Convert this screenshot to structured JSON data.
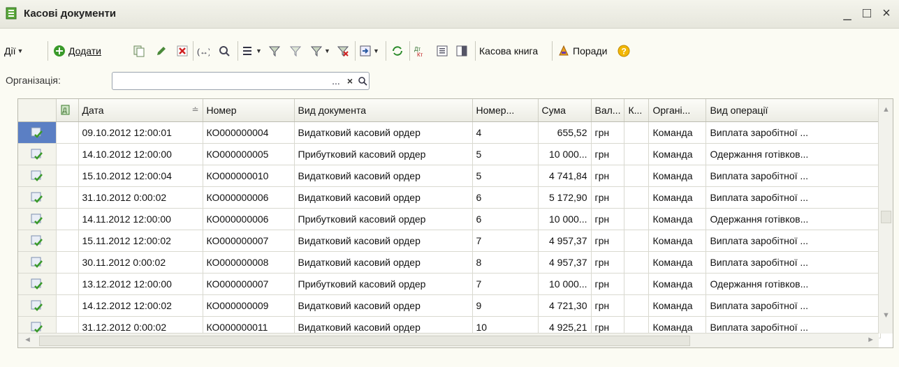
{
  "window": {
    "title": "Касові документи",
    "controls": {
      "minimize": "_",
      "maximize": "□",
      "close": "×"
    }
  },
  "toolbar": {
    "actions_label": "Дії",
    "add_label": "Додати",
    "cash_book_label": "Касова книга",
    "tips_label": "Поради"
  },
  "filter": {
    "organization_label": "Організація:",
    "organization_value": "",
    "select_button": "...",
    "clear_button": "×"
  },
  "table": {
    "columns": [
      "Дата",
      "Номер",
      "Вид документа",
      "Номер...",
      "Сума",
      "Вал...",
      "К...",
      "Органі...",
      "Вид операції"
    ],
    "rows": [
      [
        "09.10.2012 12:00:01",
        "КО000000004",
        "Видатковий касовий ордер",
        "4",
        "655,52",
        "грн",
        "",
        "Команда",
        "Виплата заробітної ..."
      ],
      [
        "14.10.2012 12:00:00",
        "КО000000005",
        "Прибутковий касовий ордер",
        "5",
        "10 000...",
        "грн",
        "",
        "Команда",
        "Одержання готівков..."
      ],
      [
        "15.10.2012 12:00:04",
        "КО000000010",
        "Видатковий касовий ордер",
        "5",
        "4 741,84",
        "грн",
        "",
        "Команда",
        "Виплата заробітної ..."
      ],
      [
        "31.10.2012 0:00:02",
        "КО000000006",
        "Видатковий касовий ордер",
        "6",
        "5 172,90",
        "грн",
        "",
        "Команда",
        "Виплата заробітної ..."
      ],
      [
        "14.11.2012 12:00:00",
        "КО000000006",
        "Прибутковий касовий ордер",
        "6",
        "10 000...",
        "грн",
        "",
        "Команда",
        "Одержання готівков..."
      ],
      [
        "15.11.2012 12:00:02",
        "КО000000007",
        "Видатковий касовий ордер",
        "7",
        "4 957,37",
        "грн",
        "",
        "Команда",
        "Виплата заробітної ..."
      ],
      [
        "30.11.2012 0:00:02",
        "КО000000008",
        "Видатковий касовий ордер",
        "8",
        "4 957,37",
        "грн",
        "",
        "Команда",
        "Виплата заробітної ..."
      ],
      [
        "13.12.2012 12:00:00",
        "КО000000007",
        "Прибутковий касовий ордер",
        "7",
        "10 000...",
        "грн",
        "",
        "Команда",
        "Одержання готівков..."
      ],
      [
        "14.12.2012 12:00:02",
        "КО000000009",
        "Видатковий касовий ордер",
        "9",
        "4 721,30",
        "грн",
        "",
        "Команда",
        "Виплата заробітної ..."
      ],
      [
        "31.12.2012 0:00:02",
        "КО000000011",
        "Видатковий касовий ордер",
        "10",
        "4 925,21",
        "грн",
        "",
        "Команда",
        "Виплата заробітної ..."
      ]
    ],
    "selected_row": 0
  },
  "colors": {
    "accent_green": "#3a9a2a",
    "selection_blue": "#5b7fc4",
    "help_yellow": "#f2b705"
  }
}
